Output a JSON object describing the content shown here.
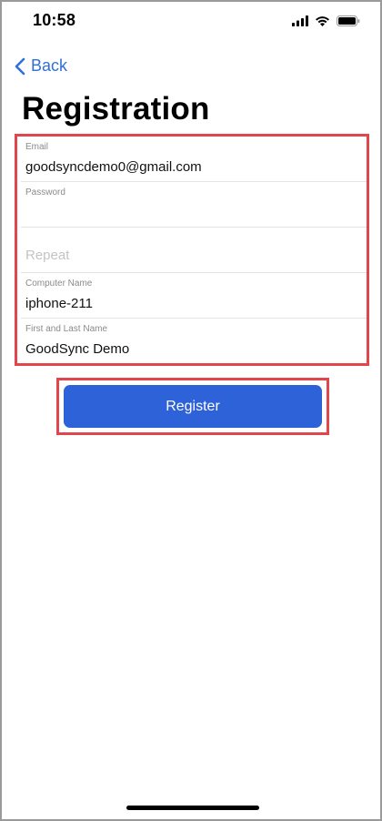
{
  "status_bar": {
    "time": "10:58",
    "icons": [
      "cellular-signal-icon",
      "wifi-icon",
      "battery-icon"
    ]
  },
  "nav": {
    "back_label": "Back",
    "back_icon": "chevron-left-icon",
    "accent_color": "#2f6fd8"
  },
  "page": {
    "title": "Registration"
  },
  "form": {
    "email": {
      "label": "Email",
      "value": "goodsyncdemo0@gmail.com"
    },
    "password": {
      "label": "Password",
      "value": ""
    },
    "repeat": {
      "placeholder": "Repeat",
      "value": ""
    },
    "computer_name": {
      "label": "Computer Name",
      "value": "iphone-211"
    },
    "full_name": {
      "label": "First and Last Name",
      "value": "GoodSync Demo"
    }
  },
  "actions": {
    "register_label": "Register",
    "button_color": "#2e62d8",
    "highlight_color": "#e0464c"
  }
}
